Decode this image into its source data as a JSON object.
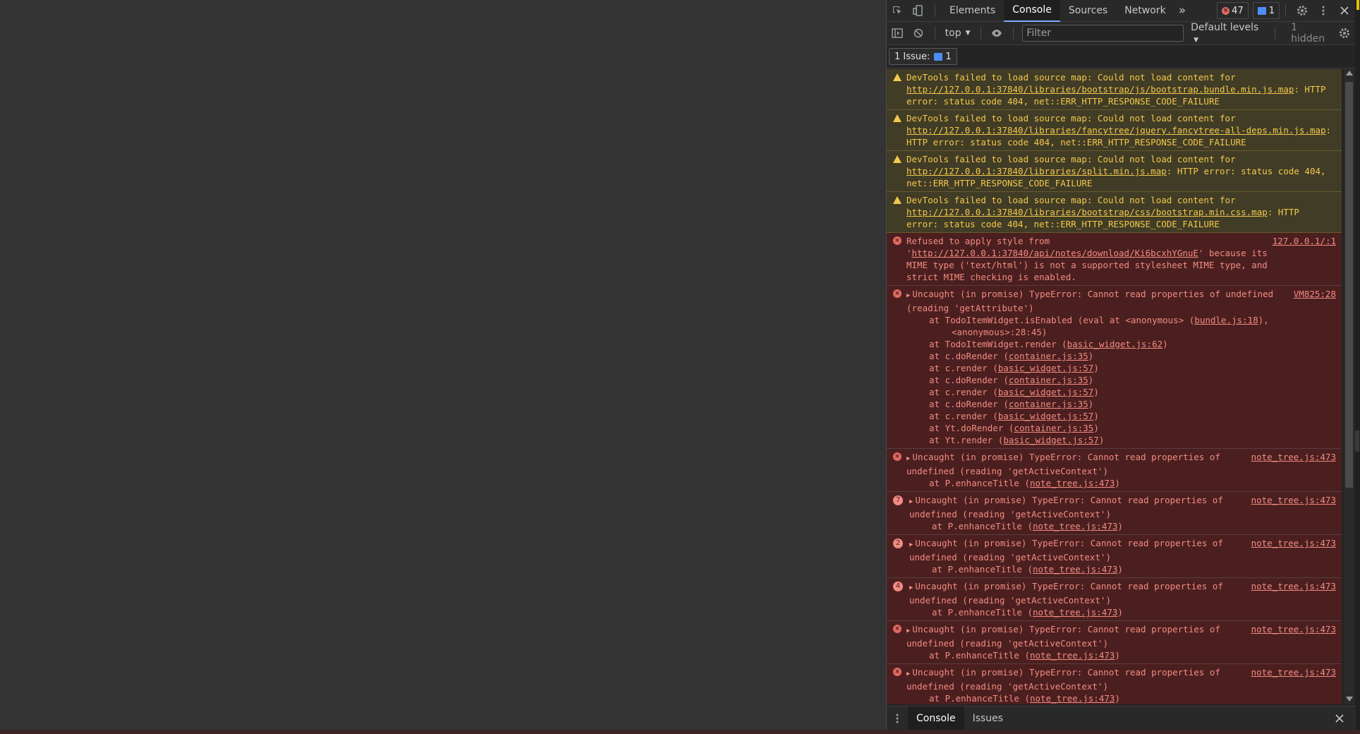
{
  "toolbar": {
    "tabs": [
      "Elements",
      "Console",
      "Sources",
      "Network"
    ],
    "more": "»",
    "error_count": "47",
    "issue_count": "1"
  },
  "console_bar": {
    "context": "top",
    "filter_placeholder": "Filter",
    "levels": "Default levels",
    "hidden": "1 hidden"
  },
  "issues_button": {
    "label": "1 Issue:",
    "count": "1"
  },
  "messages": [
    {
      "level": "warning",
      "pre": "DevTools failed to load source map: Could not load content for ",
      "link": "http://127.0.0.1:37840/libraries/bootstrap/js/bootstrap.bundle.min.js.map",
      "post": ": HTTP error: status code 404, net::ERR_HTTP_RESPONSE_CODE_FAILURE"
    },
    {
      "level": "warning",
      "pre": "DevTools failed to load source map: Could not load content for ",
      "link": "http://127.0.0.1:37840/libraries/fancytree/jquery.fancytree-all-deps.min.js.map",
      "post": ": HTTP error: status code 404, net::ERR_HTTP_RESPONSE_CODE_FAILURE"
    },
    {
      "level": "warning",
      "pre": "DevTools failed to load source map: Could not load content for ",
      "link": "http://127.0.0.1:37840/libraries/split.min.js.map",
      "post": ": HTTP error: status code 404, net::ERR_HTTP_RESPONSE_CODE_FAILURE"
    },
    {
      "level": "warning",
      "pre": "DevTools failed to load source map: Could not load content for ",
      "link": "http://127.0.0.1:37840/libraries/bootstrap/css/bootstrap.min.css.map",
      "post": ": HTTP error: status code 404, net::ERR_HTTP_RESPONSE_CODE_FAILURE"
    },
    {
      "level": "error",
      "pre": "Refused to apply style from '",
      "link": "http://127.0.0.1:37840/api/notes/download/Ki6bcxhYGnuE",
      "post": "' because its MIME type ('text/html') is not a supported stylesheet MIME type, and strict MIME checking is enabled.",
      "source": "127.0.0.1/:1"
    }
  ],
  "todo_error": {
    "head": "Uncaught (in promise) TypeError: Cannot read properties of undefined (reading 'getAttribute')",
    "source": "VM825:28",
    "line1_pre": "at TodoItemWidget.isEnabled (eval at <anonymous> (",
    "line1_link": "bundle.js:18",
    "line1_post": "), <anonymous>:28:45)",
    "frames": [
      {
        "fn": "at TodoItemWidget.render (",
        "file": "basic_widget.js:62"
      },
      {
        "fn": "at c.doRender (",
        "file": "container.js:35"
      },
      {
        "fn": "at c.render (",
        "file": "basic_widget.js:57"
      },
      {
        "fn": "at c.doRender (",
        "file": "container.js:35"
      },
      {
        "fn": "at c.render (",
        "file": "basic_widget.js:57"
      },
      {
        "fn": "at c.doRender (",
        "file": "container.js:35"
      },
      {
        "fn": "at c.render (",
        "file": "basic_widget.js:57"
      },
      {
        "fn": "at Yt.doRender (",
        "file": "container.js:35"
      },
      {
        "fn": "at Yt.render (",
        "file": "basic_widget.js:57"
      }
    ]
  },
  "tree_errors": [
    {
      "count": "",
      "head": "Uncaught (in promise) TypeError: Cannot read properties of undefined (reading 'getActiveContext')",
      "frame": "at P.enhanceTitle (",
      "file": "note_tree.js:473",
      "source": "note_tree.js:473"
    },
    {
      "count": "7",
      "head": "Uncaught (in promise) TypeError: Cannot read properties of undefined (reading 'getActiveContext')",
      "frame": "at P.enhanceTitle (",
      "file": "note_tree.js:473",
      "source": "note_tree.js:473"
    },
    {
      "count": "2",
      "head": "Uncaught (in promise) TypeError: Cannot read properties of undefined (reading 'getActiveContext')",
      "frame": "at P.enhanceTitle (",
      "file": "note_tree.js:473",
      "source": "note_tree.js:473"
    },
    {
      "count": "4",
      "head": "Uncaught (in promise) TypeError: Cannot read properties of undefined (reading 'getActiveContext')",
      "frame": "at P.enhanceTitle (",
      "file": "note_tree.js:473",
      "source": "note_tree.js:473"
    },
    {
      "count": "",
      "head": "Uncaught (in promise) TypeError: Cannot read properties of undefined (reading 'getActiveContext')",
      "frame": "at P.enhanceTitle (",
      "file": "note_tree.js:473",
      "source": "note_tree.js:473"
    },
    {
      "count": "",
      "head": "Uncaught (in promise) TypeError: Cannot read properties of undefined (reading 'getActiveContext')",
      "frame": "at P.enhanceTitle (",
      "file": "note_tree.js:473",
      "source": "note_tree.js:473"
    },
    {
      "count": "",
      "head": "Uncaught (in promise) TypeError: Cannot read properties",
      "frame": "",
      "file": "",
      "source": "note_tree.js:473"
    }
  ],
  "drawer": {
    "tabs": [
      "Console",
      "Issues"
    ]
  },
  "colors": {
    "warning_bg": "#413c26",
    "warning_text": "#f2c94c",
    "error_bg": "#4b1f1f",
    "error_text": "#f28b82",
    "accent": "#7cacf8"
  }
}
